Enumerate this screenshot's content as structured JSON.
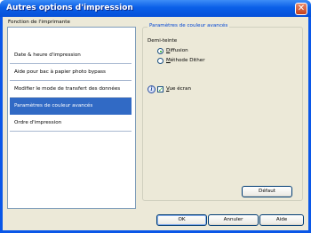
{
  "window": {
    "title": "Autres options d'impression",
    "close_glyph": "✕"
  },
  "left": {
    "group_label": "Fonction de l'imprimante",
    "items": [
      {
        "label": "Date & heure d'impression",
        "selected": false
      },
      {
        "label": "Aide pour bac à papier photo bypass",
        "selected": false
      },
      {
        "label": "Modifier le mode de transfert des données",
        "selected": false
      },
      {
        "label": "Paramètres de couleur avancés",
        "selected": true
      },
      {
        "label": "Ordre d'impression",
        "selected": false
      }
    ]
  },
  "right": {
    "group_title": "Paramètres de couleur avancés",
    "halftone_label": "Demi-teinte",
    "radio_diffusion": {
      "label_first": "D",
      "label_rest": "iffusion",
      "checked": true
    },
    "radio_dither": {
      "label_first": "M",
      "label_rest": "éthode Dither",
      "checked": false
    },
    "info_glyph": "i",
    "screen_view": {
      "label_first": "V",
      "label_rest": "ue écran",
      "checked": true
    },
    "default_button": "Défaut"
  },
  "footer": {
    "ok": "OK",
    "cancel": "Annuler",
    "help": "Aide"
  },
  "icons": {
    "check_glyph": "✓"
  },
  "colors": {
    "titlebar": "#0a5fe8",
    "selection": "#316ac5",
    "group_title": "#0046d5",
    "dialog_bg": "#ece9d8"
  }
}
